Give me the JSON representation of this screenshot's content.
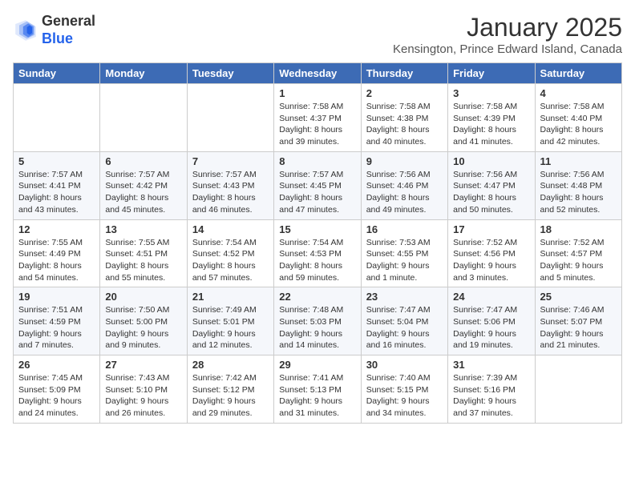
{
  "header": {
    "logo_general": "General",
    "logo_blue": "Blue",
    "month_title": "January 2025",
    "location": "Kensington, Prince Edward Island, Canada"
  },
  "days_of_week": [
    "Sunday",
    "Monday",
    "Tuesday",
    "Wednesday",
    "Thursday",
    "Friday",
    "Saturday"
  ],
  "weeks": [
    [
      {
        "day": "",
        "content": ""
      },
      {
        "day": "",
        "content": ""
      },
      {
        "day": "",
        "content": ""
      },
      {
        "day": "1",
        "content": "Sunrise: 7:58 AM\nSunset: 4:37 PM\nDaylight: 8 hours and 39 minutes."
      },
      {
        "day": "2",
        "content": "Sunrise: 7:58 AM\nSunset: 4:38 PM\nDaylight: 8 hours and 40 minutes."
      },
      {
        "day": "3",
        "content": "Sunrise: 7:58 AM\nSunset: 4:39 PM\nDaylight: 8 hours and 41 minutes."
      },
      {
        "day": "4",
        "content": "Sunrise: 7:58 AM\nSunset: 4:40 PM\nDaylight: 8 hours and 42 minutes."
      }
    ],
    [
      {
        "day": "5",
        "content": "Sunrise: 7:57 AM\nSunset: 4:41 PM\nDaylight: 8 hours and 43 minutes."
      },
      {
        "day": "6",
        "content": "Sunrise: 7:57 AM\nSunset: 4:42 PM\nDaylight: 8 hours and 45 minutes."
      },
      {
        "day": "7",
        "content": "Sunrise: 7:57 AM\nSunset: 4:43 PM\nDaylight: 8 hours and 46 minutes."
      },
      {
        "day": "8",
        "content": "Sunrise: 7:57 AM\nSunset: 4:45 PM\nDaylight: 8 hours and 47 minutes."
      },
      {
        "day": "9",
        "content": "Sunrise: 7:56 AM\nSunset: 4:46 PM\nDaylight: 8 hours and 49 minutes."
      },
      {
        "day": "10",
        "content": "Sunrise: 7:56 AM\nSunset: 4:47 PM\nDaylight: 8 hours and 50 minutes."
      },
      {
        "day": "11",
        "content": "Sunrise: 7:56 AM\nSunset: 4:48 PM\nDaylight: 8 hours and 52 minutes."
      }
    ],
    [
      {
        "day": "12",
        "content": "Sunrise: 7:55 AM\nSunset: 4:49 PM\nDaylight: 8 hours and 54 minutes."
      },
      {
        "day": "13",
        "content": "Sunrise: 7:55 AM\nSunset: 4:51 PM\nDaylight: 8 hours and 55 minutes."
      },
      {
        "day": "14",
        "content": "Sunrise: 7:54 AM\nSunset: 4:52 PM\nDaylight: 8 hours and 57 minutes."
      },
      {
        "day": "15",
        "content": "Sunrise: 7:54 AM\nSunset: 4:53 PM\nDaylight: 8 hours and 59 minutes."
      },
      {
        "day": "16",
        "content": "Sunrise: 7:53 AM\nSunset: 4:55 PM\nDaylight: 9 hours and 1 minute."
      },
      {
        "day": "17",
        "content": "Sunrise: 7:52 AM\nSunset: 4:56 PM\nDaylight: 9 hours and 3 minutes."
      },
      {
        "day": "18",
        "content": "Sunrise: 7:52 AM\nSunset: 4:57 PM\nDaylight: 9 hours and 5 minutes."
      }
    ],
    [
      {
        "day": "19",
        "content": "Sunrise: 7:51 AM\nSunset: 4:59 PM\nDaylight: 9 hours and 7 minutes."
      },
      {
        "day": "20",
        "content": "Sunrise: 7:50 AM\nSunset: 5:00 PM\nDaylight: 9 hours and 9 minutes."
      },
      {
        "day": "21",
        "content": "Sunrise: 7:49 AM\nSunset: 5:01 PM\nDaylight: 9 hours and 12 minutes."
      },
      {
        "day": "22",
        "content": "Sunrise: 7:48 AM\nSunset: 5:03 PM\nDaylight: 9 hours and 14 minutes."
      },
      {
        "day": "23",
        "content": "Sunrise: 7:47 AM\nSunset: 5:04 PM\nDaylight: 9 hours and 16 minutes."
      },
      {
        "day": "24",
        "content": "Sunrise: 7:47 AM\nSunset: 5:06 PM\nDaylight: 9 hours and 19 minutes."
      },
      {
        "day": "25",
        "content": "Sunrise: 7:46 AM\nSunset: 5:07 PM\nDaylight: 9 hours and 21 minutes."
      }
    ],
    [
      {
        "day": "26",
        "content": "Sunrise: 7:45 AM\nSunset: 5:09 PM\nDaylight: 9 hours and 24 minutes."
      },
      {
        "day": "27",
        "content": "Sunrise: 7:43 AM\nSunset: 5:10 PM\nDaylight: 9 hours and 26 minutes."
      },
      {
        "day": "28",
        "content": "Sunrise: 7:42 AM\nSunset: 5:12 PM\nDaylight: 9 hours and 29 minutes."
      },
      {
        "day": "29",
        "content": "Sunrise: 7:41 AM\nSunset: 5:13 PM\nDaylight: 9 hours and 31 minutes."
      },
      {
        "day": "30",
        "content": "Sunrise: 7:40 AM\nSunset: 5:15 PM\nDaylight: 9 hours and 34 minutes."
      },
      {
        "day": "31",
        "content": "Sunrise: 7:39 AM\nSunset: 5:16 PM\nDaylight: 9 hours and 37 minutes."
      },
      {
        "day": "",
        "content": ""
      }
    ]
  ]
}
